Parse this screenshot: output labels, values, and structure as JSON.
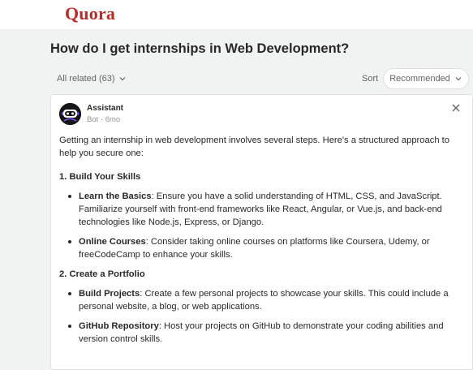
{
  "header": {
    "logo": "Quora",
    "brand_color": "#b92b27"
  },
  "question": {
    "title": "How do I get internships in Web Development?"
  },
  "controls": {
    "related_label": "All related (63)",
    "sort_label": "Sort",
    "sort_value": "Recommended"
  },
  "answer": {
    "author_name": "Assistant",
    "author_meta": "Bot · 6mo",
    "intro": "Getting an internship in web development involves several steps. Here's a structured approach to help you secure one:",
    "sections": [
      {
        "heading": "1. Build Your Skills",
        "items": [
          {
            "title": "Learn the Basics",
            "text": ": Ensure you have a solid understanding of HTML, CSS, and JavaScript. Familiarize yourself with front-end frameworks like React, Angular, or Vue.js, and back-end technologies like Node.js, Express, or Django."
          },
          {
            "title": "Online Courses",
            "text": ": Consider taking online courses on platforms like Coursera, Udemy, or freeCodeCamp to enhance your skills."
          }
        ]
      },
      {
        "heading": "2. Create a Portfolio",
        "items": [
          {
            "title": "Build Projects",
            "text": ": Create a few personal projects to showcase your skills. This could include a personal website, a blog, or web applications."
          },
          {
            "title": "GitHub Repository",
            "text": ": Host your projects on GitHub to demonstrate your coding abilities and version control skills."
          }
        ]
      }
    ]
  },
  "icons": {
    "related_toggle": "chevron-down-icon",
    "sort_toggle": "chevron-down-icon",
    "close": "close-icon",
    "avatar": "robot-avatar-icon"
  }
}
